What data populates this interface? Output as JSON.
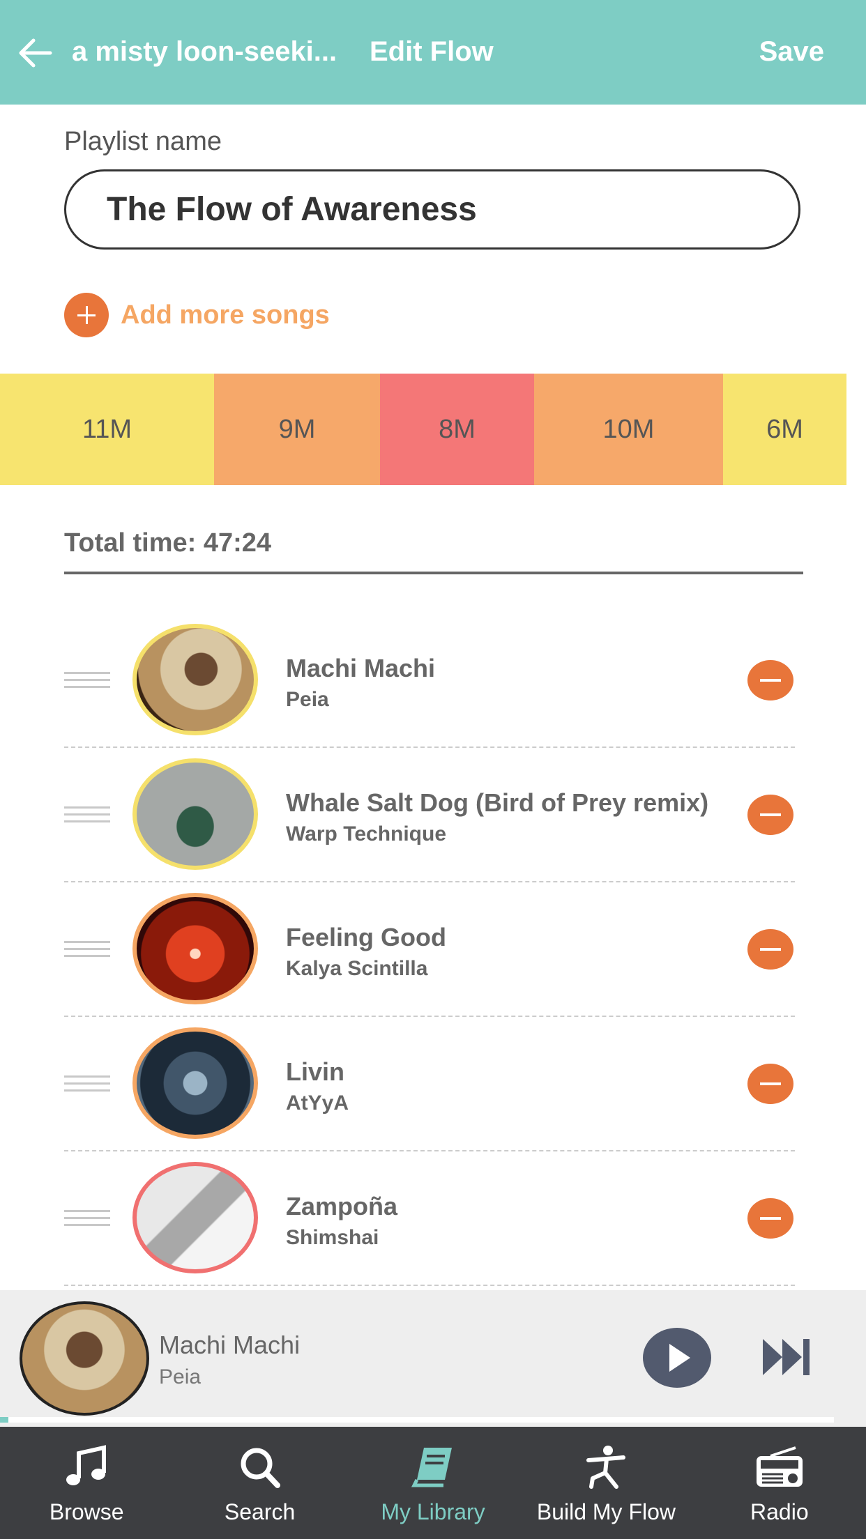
{
  "header": {
    "crumb": "a misty loon-seeki...",
    "title": "Edit Flow",
    "save_label": "Save",
    "color": "#7ecdc4"
  },
  "playlist": {
    "name_label": "Playlist name",
    "name_value": "The Flow of Awareness"
  },
  "add_more": {
    "label": "Add more songs",
    "icon": "plus-icon"
  },
  "segments": [
    {
      "label": "11M",
      "color": "#f7e46f"
    },
    {
      "label": "9M",
      "color": "#f6a86a"
    },
    {
      "label": "8M",
      "color": "#f47777"
    },
    {
      "label": "10M",
      "color": "#f6a86a"
    },
    {
      "label": "6M",
      "color": "#f7e46f"
    }
  ],
  "total_time": "Total time: 47:24",
  "songs": [
    {
      "title": "Machi Machi",
      "artist": "Peia",
      "ring_color": "#f5e06b"
    },
    {
      "title": "Whale Salt Dog (Bird of Prey remix)",
      "artist": "Warp Technique",
      "ring_color": "#f5e06b"
    },
    {
      "title": "Feeling Good",
      "artist": "Kalya Scintilla",
      "ring_color": "#f5a663"
    },
    {
      "title": "Livin",
      "artist": "AtYyA",
      "ring_color": "#f5a663"
    },
    {
      "title": "Zampoña",
      "artist": "Shimshai",
      "ring_color": "#f07070"
    }
  ],
  "now_playing": {
    "title": "Machi Machi",
    "artist": "Peia",
    "progress": 0.01
  },
  "tabs": [
    {
      "label": "Browse",
      "icon": "music-note-icon",
      "active": false
    },
    {
      "label": "Search",
      "icon": "search-icon",
      "active": false
    },
    {
      "label": "My Library",
      "icon": "book-icon",
      "active": true
    },
    {
      "label": "Build My Flow",
      "icon": "yoga-figure-icon",
      "active": false
    },
    {
      "label": "Radio",
      "icon": "radio-icon",
      "active": false
    }
  ],
  "colors": {
    "accent": "#7ecdc4",
    "remove": "#e8753a",
    "add_text": "#f5a663",
    "tabbar": "#3d3e41"
  }
}
